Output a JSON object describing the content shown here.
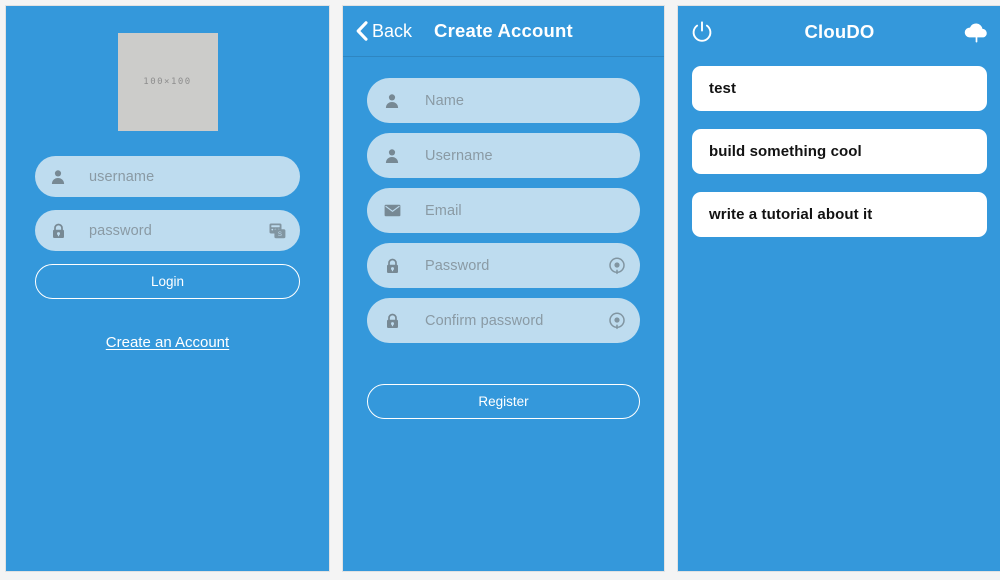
{
  "theme": {
    "brand_blue": "#3498db",
    "field_fill": "#bedcef",
    "placeholder_text": "#8a9aa4",
    "card_white": "#ffffff",
    "page_background": "#f4f4f4",
    "logo_placeholder_fill": "#ccccca"
  },
  "login_screen": {
    "logo_placeholder_label": "100×100",
    "fields": [
      {
        "icon": "user-icon",
        "placeholder": "username",
        "right_icon": null
      },
      {
        "icon": "lock-icon",
        "placeholder": "password",
        "right_icon": "keypad-icon"
      }
    ],
    "login_button_label": "Login",
    "create_account_link": "Create an Account"
  },
  "create_account_screen": {
    "back_label": "Back",
    "title": "Create Account",
    "fields": [
      {
        "icon": "user-icon",
        "placeholder": "Name",
        "right_icon": null
      },
      {
        "icon": "user-icon",
        "placeholder": "Username",
        "right_icon": null
      },
      {
        "icon": "envelope-icon",
        "placeholder": "Email",
        "right_icon": null
      },
      {
        "icon": "lock-icon",
        "placeholder": "Password",
        "right_icon": "show-password-icon"
      },
      {
        "icon": "lock-icon",
        "placeholder": "Confirm password",
        "right_icon": "show-password-icon"
      }
    ],
    "register_button_label": "Register"
  },
  "cloudo_screen": {
    "title": "ClouDO",
    "power_icon": "power-icon",
    "upload_icon": "cloud-upload-icon",
    "todos": [
      {
        "text": "test"
      },
      {
        "text": "build something cool"
      },
      {
        "text": "write a tutorial about it"
      }
    ]
  }
}
